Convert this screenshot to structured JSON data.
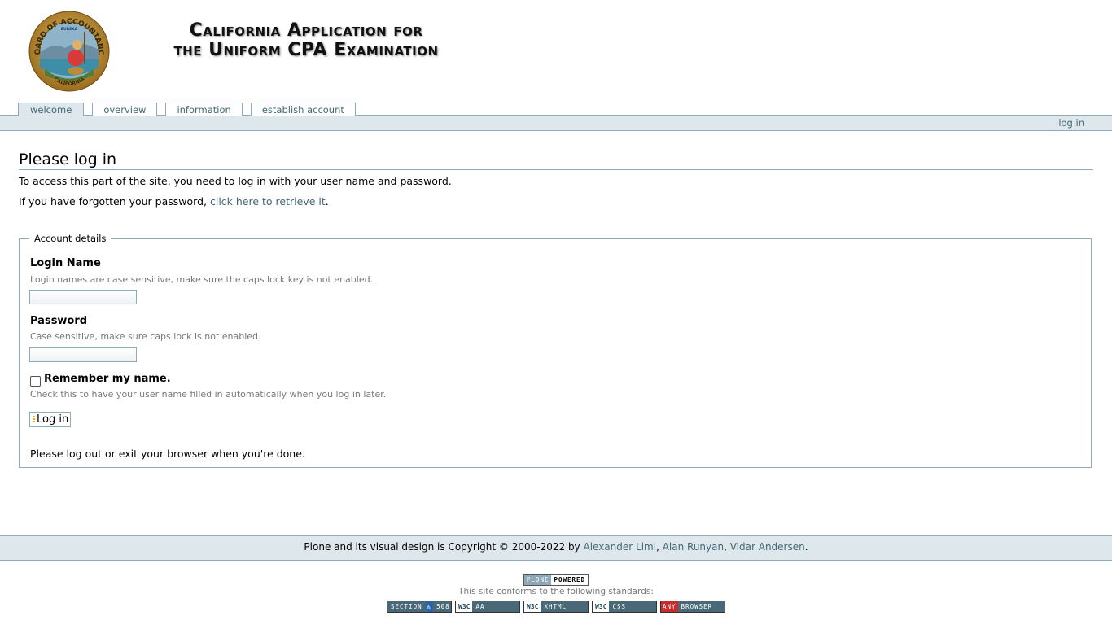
{
  "header": {
    "seal_alt": "Board of Accountancy California seal",
    "seal_text_top": "BOARD OF ACCOUNTANCY",
    "seal_text_motto": "EUREKA",
    "seal_text_bottom": "CALIFORNIA",
    "title_line1": "California Application for",
    "title_line2": "the Uniform CPA Examination"
  },
  "tabs": [
    {
      "label": "welcome",
      "selected": true
    },
    {
      "label": "overview",
      "selected": false
    },
    {
      "label": "information",
      "selected": false
    },
    {
      "label": "establish account",
      "selected": false
    }
  ],
  "personal_bar": {
    "login_label": "log in"
  },
  "main": {
    "heading": "Please log in",
    "intro": "To access this part of the site, you need to log in with your user name and password.",
    "forgot_prefix": "If you have forgotten your password, ",
    "forgot_link": "click here to retrieve it",
    "forgot_suffix": ".",
    "fieldset_legend": "Account details",
    "login_name_label": "Login Name",
    "login_name_help": "Login names are case sensitive, make sure the caps lock key is not enabled.",
    "login_name_value": "",
    "password_label": "Password",
    "password_help": "Case sensitive, make sure caps lock is not enabled.",
    "password_value": "",
    "remember_label": "Remember my name.",
    "remember_checked": false,
    "remember_help": "Check this to have your user name filled in automatically when you log in later.",
    "submit_label": "Log in",
    "logout_note": "Please log out or exit your browser when you're done."
  },
  "footer": {
    "copyright_prefix": "Plone and its visual design is Copyright © 2000-2022 by ",
    "authors": [
      "Alexander Limi",
      "Alan Runyan",
      "Vidar Andersen"
    ],
    "sep1": ", ",
    "sep2": ", ",
    "end": "."
  },
  "colophon": {
    "plone_left": "PLONE",
    "plone_right": "POWERED",
    "standards_note": "This site conforms to the following standards:",
    "badges": {
      "section508_a": "SECTION",
      "section508_b": "508",
      "w3c": "W3C",
      "aa": "AA",
      "xhtml": "XHTML",
      "css": "CSS",
      "any": "ANY",
      "browser": "BROWSER"
    }
  },
  "colors": {
    "accent_link": "#436976",
    "bar_bg": "#dee7ec",
    "border": "#8cacbb"
  }
}
